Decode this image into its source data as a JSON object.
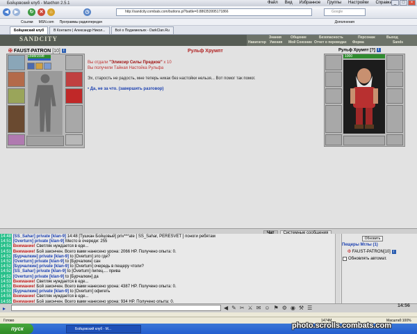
{
  "window": {
    "title": "Бойцовский клуб - Maxthon 2.5.1",
    "menu": [
      "Файл",
      "Вид",
      "Избранное",
      "Группы",
      "Настройки",
      "Справка"
    ]
  },
  "toolbar": {
    "address": "http://sandcity.combats.com/buttons.pl?battle=0.886353995171866",
    "search_placeholder": "Google"
  },
  "links": [
    "Ссылки",
    "MSN.com",
    "Программы радиопередач"
  ],
  "addons_label": "Дополнения",
  "tabs": [
    {
      "label": "Бойцовский клуб"
    },
    {
      "label": "В Контакте | Александр Никол..."
    },
    {
      "label": "Всё о Подземельях - DarkClan.Ru"
    }
  ],
  "game": {
    "logo": "SANDCITY",
    "nav_row1": [
      "Знания",
      "Общение",
      "Безопасность",
      "Персонаж",
      "Выход"
    ],
    "nav_row2": [
      "Навигатор",
      "Умения",
      "Мой Союзник",
      "Отчет о переводах",
      "Форма",
      "Sands"
    ]
  },
  "hero": {
    "name": "FAUST-PATRON",
    "level": "[10]",
    "hp": "1598/1598"
  },
  "npc": {
    "title": "Рульф Хрумпт",
    "panel_name": "Рульф Хрумпт",
    "level": "[?]",
    "hp": "1000"
  },
  "dialog": {
    "line1_pre": "Вы отдали ",
    "line1_item": "\"Эликсир Силы Предков\"",
    "line1_qty": " x 10",
    "line2": "Вы получили Тайная Настойка Рульфа",
    "speech": "Эх, старость не радость, мне теперь никак без настойки нельзя... Вот помог так помог.",
    "answer": "Да, не за что. (завершить разговор)"
  },
  "chat_tabs": [
    "Чат",
    "Системные сообщения"
  ],
  "chat": [
    {
      "time": "14:48",
      "pre": "",
      "name": "[SS_Sahar]",
      "mid": " private [klan-9] ",
      "text": "14:48 [Тушкан Бойцовый] priv***ate [ SS_Sahar, PERESVET ] поноги ребятам"
    },
    {
      "time": "14:51",
      "pre": "",
      "name": "[Overturn]",
      "mid": " private [klan-9] ",
      "text": "Место в очереди: 255"
    },
    {
      "time": "14:51",
      "pre": "Внимание! ",
      "name": "",
      "mid": "",
      "text": "Светляк нуждается в еде..."
    },
    {
      "time": "14:51",
      "pre": "Внимание! ",
      "name": "",
      "mid": "",
      "text": "Бой закончен. Всего вами нанесено урона: 2066 HP. Получено опыта: 0."
    },
    {
      "time": "14:52",
      "pre": "",
      "name": "[Бурчалкин]",
      "mid": " private [klan-9] ",
      "text": "to [Overturn] это где?"
    },
    {
      "time": "14:52",
      "pre": "",
      "name": "[Overturn]",
      "mid": " private [klan-9] ",
      "text": "to [Бурчалкин] сан"
    },
    {
      "time": "14:52",
      "pre": "",
      "name": "[Бурчалкин]",
      "mid": " private [klan-9] ",
      "text": "to [Overturn] очередь в пещеру чтоли?"
    },
    {
      "time": "14:52",
      "pre": "",
      "name": "[SS_Sahar]",
      "mid": " private [klan-9] ",
      "text": "to [Overturn] пипец.... прива"
    },
    {
      "time": "14:52",
      "pre": "",
      "name": "[Overturn]",
      "mid": " private [klan-9] ",
      "text": "to [Бурчалкин] да"
    },
    {
      "time": "14:53",
      "pre": "Внимание! ",
      "name": "",
      "mid": "",
      "text": "Светляк нуждается в еде..."
    },
    {
      "time": "14:53",
      "pre": "Внимание! ",
      "name": "",
      "mid": "",
      "text": "Бой закончен. Всего вами нанесено урона: 4387 HP. Получено опыта: 0."
    },
    {
      "time": "14:53",
      "pre": "",
      "name": "[Бурчалкин]",
      "mid": " private [klan-9] ",
      "text": "to [Overturn] офигеть"
    },
    {
      "time": "14:55",
      "pre": "Внимание! ",
      "name": "",
      "mid": "",
      "text": "Светляк нуждается в еде..."
    },
    {
      "time": "14:55",
      "pre": "Внимание! ",
      "name": "",
      "mid": "",
      "text": "Бой закончен. Всего вами нанесено урона: 934 HP. Получено опыта: 0."
    }
  ],
  "side": {
    "refresh": "Обновить",
    "location": "Пещеры Мглы (1)",
    "player": "FAUST-PATRON[10]",
    "auto": "Обновлять автомат."
  },
  "clock": "14:56",
  "status": {
    "left": "Готово",
    "mem": "1474M",
    "zoom": "Масштаб:100%"
  },
  "taskbar": {
    "start": "пуск",
    "item": "Бойцовский клуб - M..."
  },
  "watermark": "photo.scrolls.combats.com",
  "colors": {
    "chat_time_bg": "#27c08a",
    "header_bg": "#565c54",
    "npc_name": "#b02020",
    "link_blue": "#1a3fb0"
  }
}
